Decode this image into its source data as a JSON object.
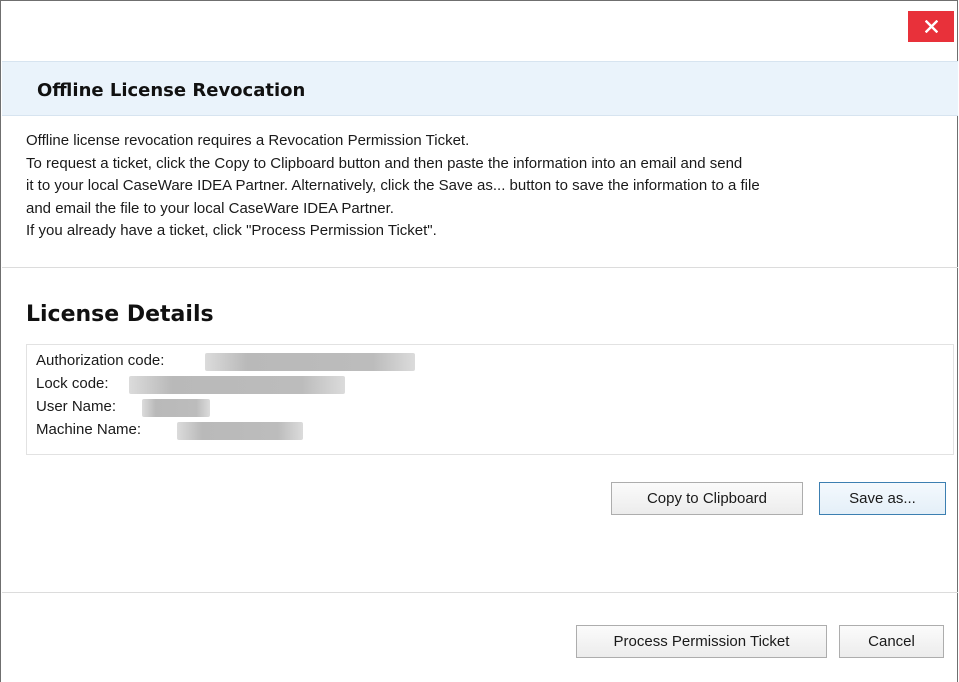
{
  "titlebar": {
    "close_icon": "close-icon"
  },
  "header": {
    "title": "Offline License Revocation"
  },
  "instructions": [
    "Offline license revocation requires a Revocation Permission Ticket.",
    "To request a ticket, click the Copy to Clipboard button and then paste the information into an email and send",
    "it to your local CaseWare IDEA Partner. Alternatively, click the Save as... button to save the information to a file",
    "and email the file to your local CaseWare IDEA Partner.",
    "If you already have a ticket, click \"Process Permission Ticket\"."
  ],
  "license_details": {
    "title": "License Details",
    "rows": [
      {
        "label": "Authorization code:",
        "value_redacted": true
      },
      {
        "label": "Lock code:",
        "value_redacted": true
      },
      {
        "label": "User Name:",
        "value_redacted": true
      },
      {
        "label": "Machine Name:",
        "value_redacted": true
      }
    ],
    "copy_button": "Copy to Clipboard",
    "save_button": "Save as..."
  },
  "footer": {
    "process_button": "Process Permission Ticket",
    "cancel_button": "Cancel"
  },
  "colors": {
    "close_button_bg": "#e8313a",
    "header_band_bg": "#eaf3fb",
    "focused_button_border": "#3c7fb1"
  }
}
